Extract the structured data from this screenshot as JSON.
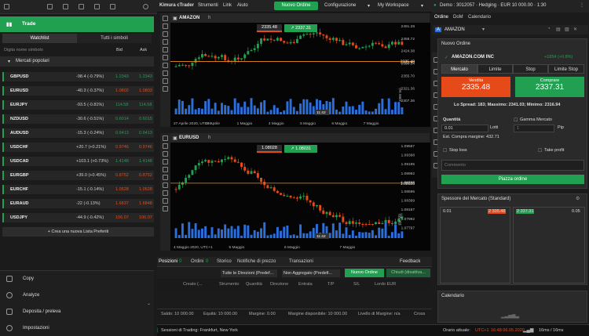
{
  "leftTop": {
    "icons": [
      "grid-icon",
      "menu-icon",
      "copy-icon",
      "user-icon",
      "chat-icon",
      "bell-icon",
      "gear-icon"
    ]
  },
  "menu": {
    "brand": "Kimura cTrader",
    "items": [
      "Strumenti",
      "Link",
      "Aiuto"
    ],
    "new_order": "Nuovo Ordine",
    "config": "Configurazione",
    "workspace": "My Workspace"
  },
  "account": {
    "label": "Demo : 3012057 · Hedging · EUR 10 000.00 · 1:30"
  },
  "trade": {
    "title": "Trade"
  },
  "watch_tabs": [
    "Watchlist",
    "Tutti i simboli"
  ],
  "search": {
    "placeholder": "Digita nome simbolo",
    "bid": "Bid",
    "ask": "Ask"
  },
  "markets": {
    "title": "Mercati popolari"
  },
  "rows": [
    {
      "sym": "GBPUSD",
      "chg": "-98.4 (-0.79%)",
      "bid": "1.2343",
      "ask": "1.2343",
      "dir": "up"
    },
    {
      "sym": "EURUSD",
      "chg": "-40.3 (-0.37%)",
      "bid": "1.0802",
      "ask": "1.0803",
      "dir": "down"
    },
    {
      "sym": "EURJPY",
      "chg": "-93.5 (-0.81%)",
      "bid": "114.58",
      "ask": "114.58",
      "dir": "up"
    },
    {
      "sym": "NZDUSD",
      "chg": "-30.6 (-0.51%)",
      "bid": "0.6014",
      "ask": "0.6015",
      "dir": "up"
    },
    {
      "sym": "AUDUSD",
      "chg": "-15.3 (-0.24%)",
      "bid": "0.6413",
      "ask": "0.6413",
      "dir": "up"
    },
    {
      "sym": "USDCHF",
      "chg": "+20.7 (+0.21%)",
      "bid": "0.9746",
      "ask": "0.9746",
      "dir": "down"
    },
    {
      "sym": "USDCAD",
      "chg": "+103.1 (+0.73%)",
      "bid": "1.4148",
      "ask": "1.4148",
      "dir": "up"
    },
    {
      "sym": "EURGBP",
      "chg": "+39.0 (+0.45%)",
      "bid": "0.8752",
      "ask": "0.8752",
      "dir": "down"
    },
    {
      "sym": "EURCHF",
      "chg": "-15.1 (-0.14%)",
      "bid": "1.0528",
      "ask": "1.0528",
      "dir": "down"
    },
    {
      "sym": "EURAUD",
      "chg": "-22 (-0.13%)",
      "bid": "1.6837",
      "ask": "1.6848",
      "dir": "down"
    },
    {
      "sym": "USDJPY",
      "chg": "-44.9 (-0.42%)",
      "bid": "106.07",
      "ask": "106.07",
      "dir": "down"
    }
  ],
  "new_list": "+ Crea una nuova Lista Preferiti",
  "left_menu": [
    "Copy",
    "Analyze",
    "Deposita / preleva",
    "Impostazioni"
  ],
  "chart1": {
    "symbol": "AMAZON",
    "sell": "2335.48",
    "buy": "2337.31",
    "price_tag": "2335.48",
    "time_tag": "11:42",
    "yticks": [
      "2491.28",
      "2458.72",
      "2424.38",
      "2390.04",
      "2355.70",
      "2321.36",
      "2307.36"
    ],
    "xticks": [
      "27 Aprile 2020, UTC+1",
      "30 Aprile",
      "1 Maggio",
      "4 Maggio",
      "5 Maggio",
      "6 Maggio",
      "7 Maggio"
    ],
    "unit": "1000 Vol."
  },
  "chart2": {
    "symbol": "EURUSD",
    "sell": "1.08028",
    "buy": "1.08031",
    "price_tag": "1.08028",
    "time_tag": "11:42",
    "yticks": [
      "1.09587",
      "1.09398",
      "1.09195",
      "1.08992",
      "1.08797",
      "1.08596",
      "1.08399",
      "1.08187",
      "1.07992",
      "1.07797"
    ],
    "xticks": [
      "4 Maggio 2020, UTC+1",
      "5 Maggio",
      "6 Maggio",
      "7 Maggio"
    ],
    "unit": "100 Vol."
  },
  "positions": {
    "tabs": [
      "Posizioni",
      "Ordini",
      "Storico",
      "Notifiche di prezzo",
      "Transazioni"
    ],
    "counts": [
      "0",
      "0"
    ],
    "feedback": "Feedback",
    "filters": [
      "Tutte le Direzioni (Predef...",
      "Non Aggregato (Predefi..."
    ],
    "new_order": "Nuovo Ordine",
    "close_all": "Chiudi (disattiva...",
    "cols": [
      "Creato (...",
      "Strumento",
      "Quantità",
      "Direzione",
      "Entrata",
      "T/P",
      "S/L",
      "Lordo EUR"
    ]
  },
  "balance": {
    "saldo": "Saldo: 10 000.00",
    "equita": "Equità: 10 000.00",
    "margine": "Margine: 0.00",
    "disp": "Margine disponibile: 10 000.00",
    "livello": "Livello di Margine: n/a",
    "cross": "Cross"
  },
  "status": {
    "session": "Sessioni di Trading: Frankfurt, New York",
    "time_label": "Orario attuale:",
    "utc": "UTC+1",
    "time": "16:48 06.05.2020",
    "latency": "16ms / 16ms"
  },
  "right": {
    "tabs": [
      "Ordine",
      "DoM",
      "Calendario"
    ],
    "symbol": "AMAZON",
    "panel_title": "Nuovo Ordine",
    "instrument": "AMAZON.COM INC",
    "change": "+1854 (+0.8%)",
    "order_types": [
      "Mercato",
      "Limite",
      "Stop",
      "Limite Stop"
    ],
    "sell_label": "Vendita",
    "sell": "2335.48",
    "buy_label": "Comprare",
    "buy": "2337.31",
    "spread": "Lo Spread: 183; Massimo: 2341.03; Minimo: 2316.94",
    "qty_label": "Quantità",
    "qty": "0.01",
    "lots": "Lotti",
    "gamma": "Gamma Mercato",
    "gamma_val": "1",
    "pip": "Pip",
    "margin": "Est. Compra margine: 432.71",
    "sl": "Stop loss",
    "tp": "Take profit",
    "comment": "Commento",
    "place": "Piazza ordine",
    "depth_title": "Spessore del Mercato (Standard)",
    "depth_sell_qty": "0.01",
    "depth_sell": "2 335.48",
    "depth_buy": "2 337.31",
    "depth_buy_qty": "0.05",
    "calendar": "Calendario"
  },
  "colors": {
    "green": "#21a052",
    "red": "#e64a19",
    "orange": "#f08c1a"
  }
}
